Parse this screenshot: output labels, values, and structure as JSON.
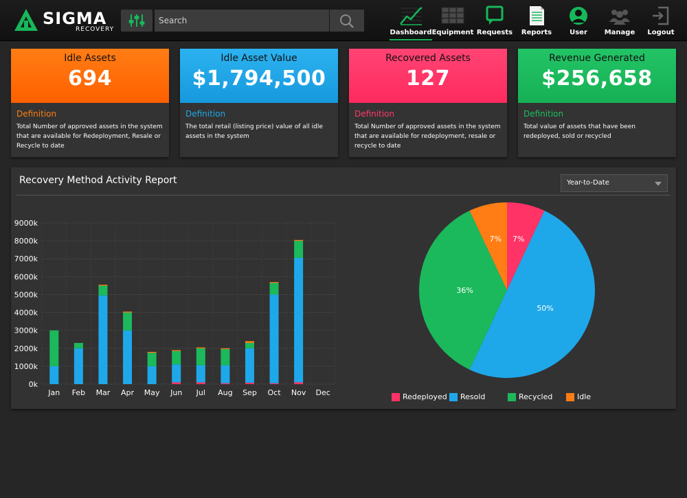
{
  "brand": {
    "name": "SIGMA",
    "sub": "RECOVERY",
    "accent": "#17b75a"
  },
  "search": {
    "placeholder": "Search"
  },
  "nav": [
    {
      "label": "Dashboard",
      "icon": "chart-line-icon",
      "active": true
    },
    {
      "label": "Equipment",
      "icon": "grid-icon",
      "active": false
    },
    {
      "label": "Requests",
      "icon": "chat-bubble-icon",
      "active": false
    },
    {
      "label": "Reports",
      "icon": "document-icon",
      "active": false
    },
    {
      "label": "User",
      "icon": "user-icon",
      "active": false
    },
    {
      "label": "Manage",
      "icon": "group-icon",
      "active": false
    },
    {
      "label": "Logout",
      "icon": "logout-icon",
      "active": false
    }
  ],
  "kpis": [
    {
      "title": "Idle Assets",
      "value": "694",
      "definition": "Definition",
      "description": "Total Number of approved assets in the system that are available for Redeployment, Resale or Recycle to date",
      "color": "#ff6a00",
      "accent": "#ff7d14"
    },
    {
      "title": "Idle Asset Value",
      "value": "$1,794,500",
      "definition": "Definition",
      "description": "The total retail (listing price) value of all idle assets in the system",
      "color": "#1aa3e6",
      "accent": "#1ea8ea"
    },
    {
      "title": "Recovered Assets",
      "value": "127",
      "definition": "Definition",
      "description": "Total Number of approved assets in the system that are available for redeployment, resale or recycle to date",
      "color": "#ff3366",
      "accent": "#ff3a6a"
    },
    {
      "title": "Revenue Generated",
      "value": "$256,658",
      "definition": "Definition",
      "description": "Total value of assets that have been redeployed, sold or recycled",
      "color": "#1cb85c",
      "accent": "#1cc060"
    }
  ],
  "report": {
    "title": "Recovery Method Activity Report",
    "range_selected": "Year-to-Date"
  },
  "chart_data": [
    {
      "type": "bar",
      "stacked": true,
      "categories": [
        "Jan",
        "Feb",
        "Mar",
        "Apr",
        "May",
        "Jun",
        "Jul",
        "Aug",
        "Sep",
        "Oct",
        "Nov",
        "Dec"
      ],
      "ylim": [
        0,
        9000
      ],
      "yticks": [
        "0k",
        "1000k",
        "2000k",
        "3000k",
        "4000k",
        "5000k",
        "6000k",
        "7000k",
        "8000k",
        "9000k"
      ],
      "grid": true,
      "series": [
        {
          "name": "Redeployed",
          "color": "#ff3366",
          "values": [
            0,
            0,
            0,
            0,
            0,
            100,
            100,
            50,
            80,
            50,
            100,
            0
          ]
        },
        {
          "name": "Resold",
          "color": "#1ea8ea",
          "values": [
            1000,
            2000,
            4950,
            3000,
            1000,
            1000,
            950,
            1000,
            1920,
            4950,
            6950,
            0
          ]
        },
        {
          "name": "Recycled",
          "color": "#1cb85c",
          "values": [
            2000,
            300,
            550,
            1000,
            750,
            750,
            950,
            900,
            300,
            650,
            950,
            0
          ]
        },
        {
          "name": "Idle",
          "color": "#ff7d14",
          "values": [
            0,
            0,
            50,
            50,
            50,
            50,
            50,
            50,
            100,
            50,
            50,
            0
          ]
        }
      ]
    },
    {
      "type": "pie",
      "slices": [
        {
          "name": "Redeployed",
          "value": 7,
          "label": "7%",
          "color": "#ff3366"
        },
        {
          "name": "Resold",
          "value": 50,
          "label": "50%",
          "color": "#1ea8ea"
        },
        {
          "name": "Recycled",
          "value": 36,
          "label": "36%",
          "color": "#1cb85c"
        },
        {
          "name": "Idle",
          "value": 7,
          "label": "7%",
          "color": "#ff7d14"
        }
      ],
      "legend": [
        "Redeployed",
        "Resold",
        "Recycled",
        "Idle"
      ],
      "legend_position": "bottom"
    }
  ]
}
